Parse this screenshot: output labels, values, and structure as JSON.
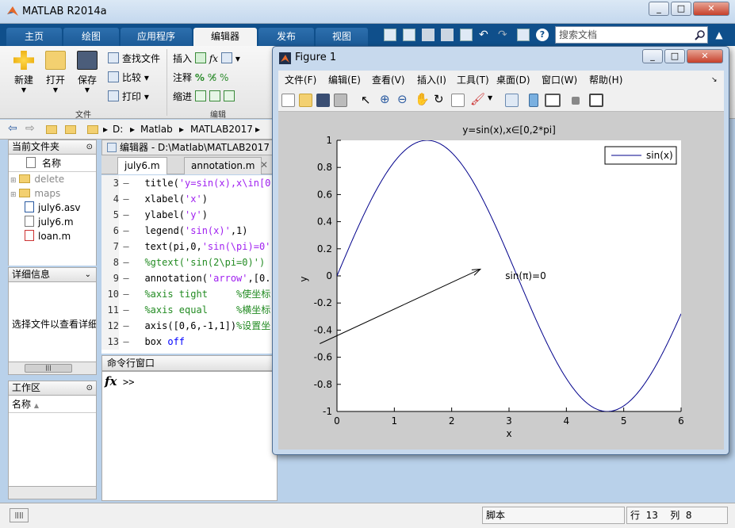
{
  "app": {
    "title": "MATLAB R2014a"
  },
  "ribbon_tabs": [
    "主页",
    "绘图",
    "应用程序",
    "编辑器",
    "发布",
    "视图"
  ],
  "search": {
    "placeholder": "搜索文档"
  },
  "ribbon": {
    "file_group": {
      "new": "新建",
      "open": "打开",
      "save": "保存",
      "label": "文件"
    },
    "nav_group": {
      "find": "查找文件",
      "compare": "比较",
      "print": "打印"
    },
    "edit_group": {
      "insert": "插入",
      "comment": "注释",
      "indent": "缩进",
      "label": "编辑"
    }
  },
  "address": {
    "drive": "D:",
    "p1": "Matlab",
    "p2": "MATLAB2017"
  },
  "current_folder": {
    "title": "当前文件夹",
    "column": "名称",
    "items": [
      {
        "name": "delete",
        "type": "folder"
      },
      {
        "name": "maps",
        "type": "folder"
      },
      {
        "name": "july6.asv",
        "type": "file"
      },
      {
        "name": "july6.m",
        "type": "file"
      },
      {
        "name": "loan.m",
        "type": "file"
      }
    ]
  },
  "details": {
    "title": "详细信息",
    "hint": "选择文件以查看详细"
  },
  "workspace": {
    "title": "工作区",
    "column": "名称"
  },
  "editor": {
    "header": "编辑器 - D:\\Matlab\\MATLAB2017",
    "tabs": [
      "july6.m",
      "annotation.m"
    ],
    "lines": [
      {
        "n": "3",
        "parts": [
          [
            "",
            "title("
          ],
          [
            "str",
            "'y=sin(x),x\\in[0"
          ]
        ]
      },
      {
        "n": "4",
        "parts": [
          [
            "",
            "xlabel("
          ],
          [
            "str",
            "'x'"
          ],
          [
            "",
            ")"
          ]
        ]
      },
      {
        "n": "5",
        "parts": [
          [
            "",
            "ylabel("
          ],
          [
            "str",
            "'y'"
          ],
          [
            "",
            ")"
          ]
        ]
      },
      {
        "n": "6",
        "parts": [
          [
            "",
            "legend("
          ],
          [
            "str",
            "'sin(x)'"
          ],
          [
            "",
            ",1)"
          ]
        ]
      },
      {
        "n": "7",
        "parts": [
          [
            "",
            "text(pi,0,"
          ],
          [
            "str",
            "'sin(\\pi)=0'"
          ]
        ]
      },
      {
        "n": "8",
        "parts": [
          [
            "com",
            "%gtext('sin(2\\pi=0)')"
          ]
        ]
      },
      {
        "n": "9",
        "parts": [
          [
            "",
            "annotation("
          ],
          [
            "str",
            "'arrow'"
          ],
          [
            "",
            ",[0."
          ]
        ]
      },
      {
        "n": "10",
        "parts": [
          [
            "com",
            "%axis tight     %使坐标"
          ]
        ]
      },
      {
        "n": "11",
        "parts": [
          [
            "com",
            "%axis equal     %横坐标"
          ]
        ]
      },
      {
        "n": "12",
        "parts": [
          [
            "",
            "axis([0,6,-1,1])"
          ],
          [
            "com",
            "%设置坐"
          ]
        ]
      },
      {
        "n": "13",
        "parts": [
          [
            "",
            "box "
          ],
          [
            "kw",
            "off"
          ]
        ]
      }
    ]
  },
  "command_window": {
    "title": "命令行窗口",
    "fx": "fx",
    "prompt": ">>"
  },
  "status": {
    "mode": "脚本",
    "row_label": "行",
    "row": "13",
    "col_label": "列",
    "col": "8"
  },
  "figure": {
    "title": "Figure 1",
    "menu": [
      "文件(F)",
      "编辑(E)",
      "查看(V)",
      "插入(I)",
      "工具(T)",
      "桌面(D)",
      "窗口(W)",
      "帮助(H)"
    ]
  },
  "chart_data": {
    "type": "line",
    "title": "y=sin(x),x∈[0,2*pi]",
    "xlabel": "x",
    "ylabel": "y",
    "xlim": [
      0,
      6
    ],
    "ylim": [
      -1,
      1
    ],
    "xticks": [
      0,
      1,
      2,
      3,
      4,
      5,
      6
    ],
    "yticks": [
      1,
      0.8,
      0.6,
      0.4,
      0.2,
      0,
      -0.2,
      -0.4,
      -0.6,
      -0.8,
      -1
    ],
    "series": [
      {
        "name": "sin(x)",
        "function": "sin(x)",
        "x_range": [
          0,
          6.2832
        ],
        "color": "#00008b"
      }
    ],
    "legend": "top-right",
    "annotation_text": {
      "text": "sin(π)=0",
      "x": 3.1416,
      "y": 0
    },
    "arrow": {
      "from": [
        -0.3,
        -0.5
      ],
      "to": [
        2.5,
        0.05
      ]
    },
    "grid": false
  }
}
